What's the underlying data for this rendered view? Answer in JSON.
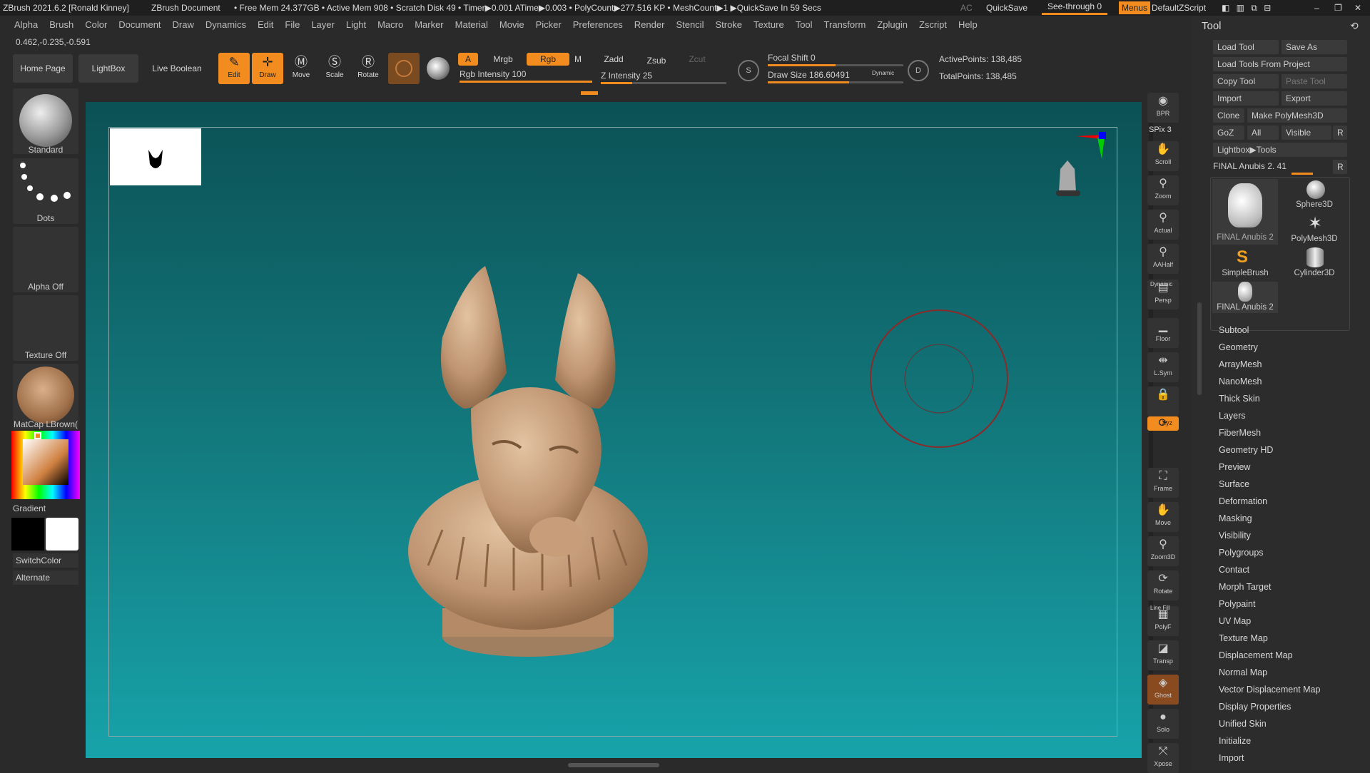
{
  "titlebar": {
    "app": "ZBrush 2021.6.2 [Ronald Kinney]",
    "document": "ZBrush Document",
    "stats": "• Free Mem 24.377GB • Active Mem 908 • Scratch Disk 49 •  Timer▶0.001 ATime▶0.003 • PolyCount▶277.516 KP  • MeshCount▶1  ▶QuickSave In 59 Secs",
    "ac": "AC",
    "quicksave": "QuickSave",
    "seethrough": "See-through  0",
    "menus": "Menus",
    "script": "DefaultZScript"
  },
  "menubar": [
    "Alpha",
    "Brush",
    "Color",
    "Document",
    "Draw",
    "Dynamics",
    "Edit",
    "File",
    "Layer",
    "Light",
    "Macro",
    "Marker",
    "Material",
    "Movie",
    "Picker",
    "Preferences",
    "Render",
    "Stencil",
    "Stroke",
    "Texture",
    "Tool",
    "Transform",
    "Zplugin",
    "Zscript",
    "Help"
  ],
  "coords": "0.462,-0.235,-0.591",
  "toolbar": {
    "home": "Home Page",
    "lightbox": "LightBox",
    "liveboolean": "Live Boolean",
    "edit": "Edit",
    "draw": "Draw",
    "move": "Move",
    "scale": "Scale",
    "rotate": "Rotate",
    "a": "A",
    "mrgb": "Mrgb",
    "rgb": "Rgb",
    "m": "M",
    "rgb_intensity": "Rgb Intensity 100",
    "zadd": "Zadd",
    "zsub": "Zsub",
    "zcut": "Zcut",
    "z_intensity": "Z Intensity 25",
    "focal_shift": "Focal Shift 0",
    "draw_size": "Draw Size 186.60491",
    "dynamic": "Dynamic",
    "active_points": "ActivePoints: 138,485",
    "total_points": "TotalPoints: 138,485",
    "s": "S",
    "d": "D"
  },
  "levels": {
    "rgb_intensity": 1.0,
    "z_intensity": 0.25,
    "focal_shift": 0.5,
    "draw_size": 0.6
  },
  "leftshelf": {
    "brush": "Standard",
    "stroke": "Dots",
    "alpha": "Alpha Off",
    "texture": "Texture Off",
    "material": "MatCap LBrown(",
    "gradient": "Gradient",
    "switchcolor": "SwitchColor",
    "alternate": "Alternate"
  },
  "rightshelf": [
    {
      "label": "BPR",
      "icon": "bpr-icon"
    },
    {
      "label": "Scroll",
      "icon": "hand-icon"
    },
    {
      "label": "Zoom",
      "icon": "zoom-icon"
    },
    {
      "label": "Actual",
      "icon": "zoom-actual-icon"
    },
    {
      "label": "AAHalf",
      "icon": "zoom-half-icon"
    },
    {
      "label": "Persp",
      "icon": "persp-icon"
    },
    {
      "label": "Floor",
      "icon": "floor-icon"
    },
    {
      "label": "L.Sym",
      "icon": "lsym-icon"
    },
    {
      "label": "",
      "icon": "lock-icon"
    },
    {
      "label": "Xyz",
      "icon": "xyz-icon"
    },
    {
      "label": "Frame",
      "icon": "frame-icon"
    },
    {
      "label": "Move",
      "icon": "move-icon"
    },
    {
      "label": "Zoom3D",
      "icon": "zoom3d-icon"
    },
    {
      "label": "Rotate",
      "icon": "rotate-icon"
    },
    {
      "label": "PolyF",
      "icon": "polyf-icon"
    },
    {
      "label": "Transp",
      "icon": "transp-icon"
    },
    {
      "label": "Ghost",
      "icon": "ghost-icon"
    },
    {
      "label": "Solo",
      "icon": "solo-icon"
    },
    {
      "label": "Xpose",
      "icon": "xpose-icon"
    }
  ],
  "spix": "SPix 3",
  "dynamic_label": "Dynamic",
  "linefill_label": "Line Fill",
  "toolpanel": {
    "title": "Tool",
    "load_tool": "Load Tool",
    "save_as": "Save As",
    "load_from_project": "Load Tools From Project",
    "copy_tool": "Copy Tool",
    "paste_tool": "Paste Tool",
    "import": "Import",
    "export": "Export",
    "clone": "Clone",
    "make_polymesh": "Make PolyMesh3D",
    "goz": "GoZ",
    "all": "All",
    "visible": "Visible",
    "r": "R",
    "lightbox_tools": "Lightbox▶Tools",
    "current_tool": "FINAL Anubis 2. 41",
    "tools": [
      "FINAL Anubis 2",
      "Sphere3D",
      "PolyMesh3D",
      "SimpleBrush",
      "Cylinder3D",
      "FINAL Anubis 2"
    ],
    "subpalettes": [
      "Subtool",
      "Geometry",
      "ArrayMesh",
      "NanoMesh",
      "Thick Skin",
      "Layers",
      "FiberMesh",
      "Geometry HD",
      "Preview",
      "Surface",
      "Deformation",
      "Masking",
      "Visibility",
      "Polygroups",
      "Contact",
      "Morph Target",
      "Polypaint",
      "UV Map",
      "Texture Map",
      "Displacement Map",
      "Normal Map",
      "Vector Displacement Map",
      "Display Properties",
      "Unified Skin",
      "Initialize",
      "Import"
    ]
  },
  "colors": {
    "accent": "#f28c1e",
    "model": "#c8a07e",
    "viewport_top": "#0b5155",
    "viewport_bottom": "#17a3aa"
  }
}
